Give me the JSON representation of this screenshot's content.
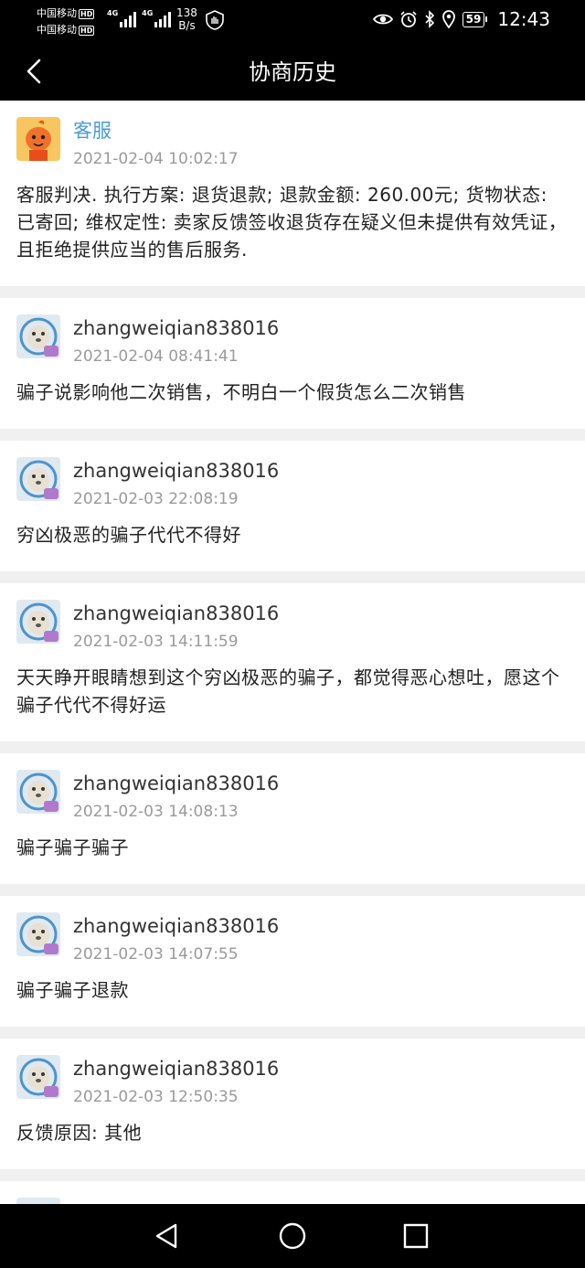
{
  "status": {
    "carrier1": "中国移动",
    "carrier2": "中国移动",
    "hd": "HD",
    "net1": "4G",
    "net2": "4G",
    "speed_value": "138",
    "speed_unit": "B/s",
    "battery": "59",
    "time": "12:43"
  },
  "header": {
    "title": "协商历史"
  },
  "messages": [
    {
      "name": "客服",
      "time": "2021-02-04 10:02:17",
      "text": "客服判决. 执行方案: 退货退款; 退款金额: 260.00元; 货物状态: 已寄回; 维权定性: 卖家反馈签收退货存在疑义但未提供有效凭证，且拒绝提供应当的售后服务."
    },
    {
      "name": "zhangweiqian838016",
      "time": "2021-02-04 08:41:41",
      "text": "骗子说影响他二次销售，不明白一个假货怎么二次销售"
    },
    {
      "name": "zhangweiqian838016",
      "time": "2021-02-03 22:08:19",
      "text": "穷凶极恶的骗子代代不得好"
    },
    {
      "name": "zhangweiqian838016",
      "time": "2021-02-03 14:11:59",
      "text": "天天睁开眼睛想到这个穷凶极恶的骗子，都觉得恶心想吐，愿这个骗子代代不得好运"
    },
    {
      "name": "zhangweiqian838016",
      "time": "2021-02-03 14:08:13",
      "text": "骗子骗子骗子"
    },
    {
      "name": "zhangweiqian838016",
      "time": "2021-02-03 14:07:55",
      "text": "骗子骗子退款"
    },
    {
      "name": "zhangweiqian838016",
      "time": "2021-02-03 12:50:35",
      "text": "反馈原因: 其他"
    }
  ],
  "icons": {
    "back": "chevron-left-icon",
    "eye": "eye-icon",
    "alarm": "alarm-icon",
    "bluetooth": "bluetooth-icon",
    "location": "location-icon",
    "nav_back": "triangle-back-icon",
    "nav_home": "circle-home-icon",
    "nav_recent": "square-recent-icon"
  },
  "colors": {
    "cs_name": "#4a9bd8",
    "time": "#9a9a9a",
    "bar": "#000000"
  }
}
